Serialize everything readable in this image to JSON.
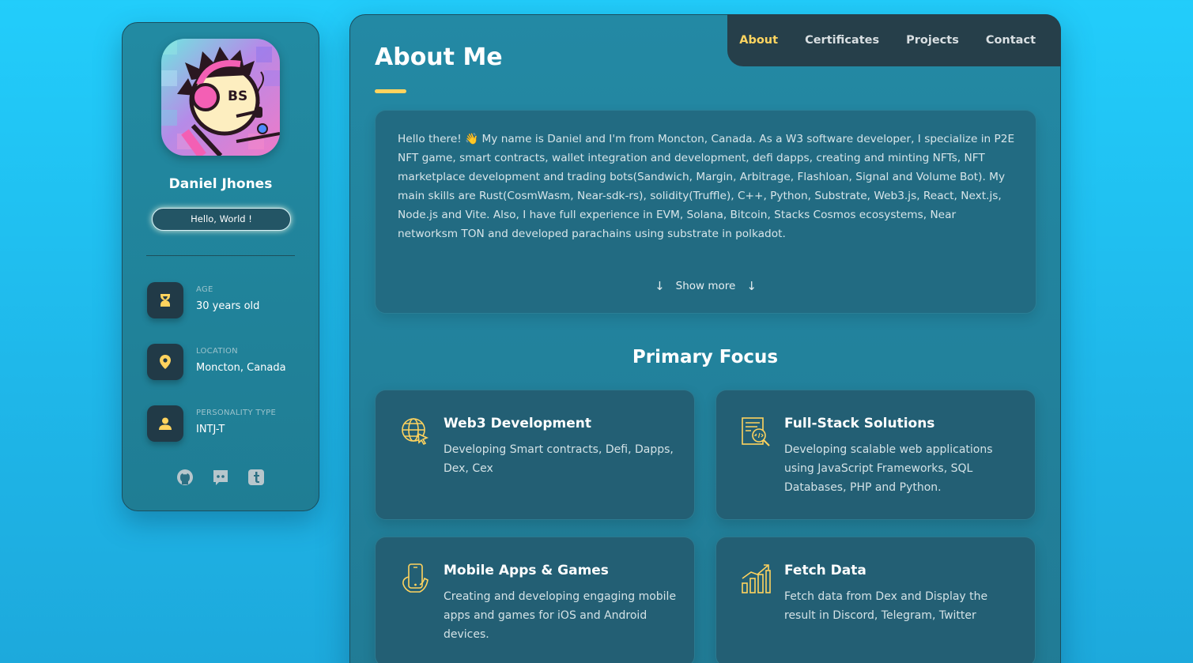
{
  "profile": {
    "name": "Daniel Jhones",
    "status": "Hello, World !",
    "avatar_text": "BS"
  },
  "info": [
    {
      "label": "AGE",
      "value": "30 years old",
      "icon": "hourglass-icon"
    },
    {
      "label": "LOCATION",
      "value": "Moncton, Canada",
      "icon": "map-pin-icon"
    },
    {
      "label": "PERSONALITY TYPE",
      "value": "INTJ-T",
      "icon": "user-icon"
    }
  ],
  "socials": [
    "github-icon",
    "discord-icon",
    "tumblr-icon"
  ],
  "nav": {
    "items": [
      "About",
      "Certificates",
      "Projects",
      "Contact"
    ],
    "active": "About"
  },
  "page": {
    "title": "About Me",
    "about_text": "Hello there! 👋 My name is Daniel and I'm from Moncton, Canada. As a W3 software developer, I specialize in P2E NFT game, smart contracts, wallet integration and development, defi dapps, creating and minting NFTs, NFT marketplace development and trading bots(Sandwich, Margin, Arbitrage, Flashloan, Signal and Volume Bot). My main skills are Rust(CosmWasm, Near-sdk-rs), solidity(Truffle), C++, Python, Substrate, Web3.js, React, Next.js, Node.js and Vite. Also, I have full experience in EVM, Solana, Bitcoin, Stacks Cosmos ecosystems, Near networksm TON and developed parachains using substrate in polkadot.",
    "show_more": "Show more",
    "section_title": "Primary Focus"
  },
  "focus": [
    {
      "title": "Web3 Development",
      "desc": "Developing Smart contracts, Defi, Dapps, Dex, Cex",
      "icon": "globe-cursor-icon"
    },
    {
      "title": "Full-Stack Solutions",
      "desc": "Developing scalable web applications using JavaScript Frameworks, SQL Databases, PHP and Python.",
      "icon": "code-document-icon"
    },
    {
      "title": "Mobile Apps & Games",
      "desc": "Creating and developing engaging mobile apps and games for iOS and Android devices.",
      "icon": "mobile-hand-icon"
    },
    {
      "title": "Fetch Data",
      "desc": "Fetch data from Dex and Display the result in Discord, Telegram, Twitter",
      "icon": "bar-chart-icon"
    }
  ],
  "colors": {
    "accent": "#ffd35e",
    "background": "#22cdfb",
    "card": "#226b82",
    "icon_box": "#213a47"
  }
}
